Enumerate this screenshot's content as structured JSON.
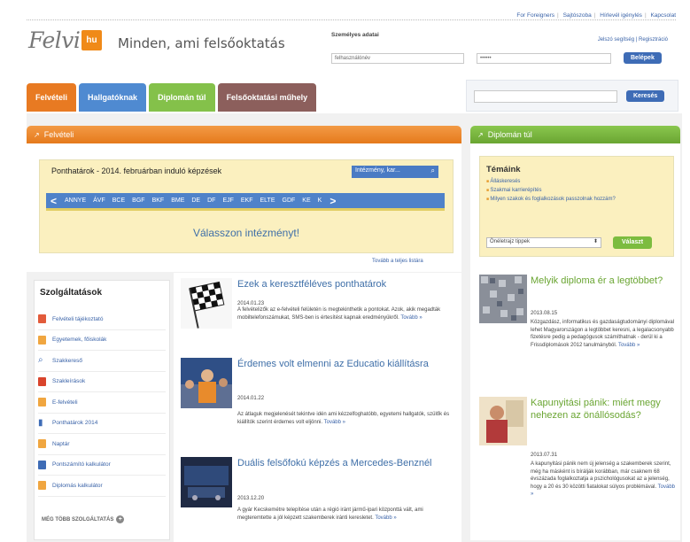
{
  "toplinks": [
    "For Foreigners",
    "Sajtószoba",
    "Hírlevél igénylés",
    "Kapcsolat"
  ],
  "logo": {
    "word": "Felvi",
    "box": "hu"
  },
  "tagline": "Minden, ami felsőoktatás",
  "login": {
    "title": "Személyes adatai",
    "links": [
      "Jelszó segítség",
      "Regisztráció"
    ],
    "user_value": "felhasználónév",
    "pass_value": "••••••",
    "button": "Belépek"
  },
  "nav": [
    {
      "label": "Felvételi",
      "color": "#e87a22"
    },
    {
      "label": "Hallgatóknak",
      "color": "#4f8ad1"
    },
    {
      "label": "Diplomán túl",
      "color": "#84c14a"
    },
    {
      "label": "Felsőoktatási műhely",
      "color": "#8c5f5c"
    }
  ],
  "search": {
    "button": "Keresés"
  },
  "felveteli": {
    "heading": "Felvételi",
    "inst_title": "Ponthatárok - 2014. februárban induló képzések",
    "inst_search": "Intézmény, kar...",
    "abc": [
      "ANNYE",
      "ÁVF",
      "BCE",
      "BGF",
      "BKF",
      "BME",
      "DE",
      "DF",
      "EJF",
      "EKF",
      "ELTE",
      "GDF",
      "KE",
      "K"
    ],
    "choose": "Válasszon intézményt!",
    "more": "Tovább a teljes listára"
  },
  "services": {
    "title": "Szolgáltatások",
    "items": [
      {
        "label": "Felvételi tájékoztató",
        "color": "#e25b3b"
      },
      {
        "label": "Egyetemek, főiskolák",
        "color": "#f0a640"
      },
      {
        "label": "Szakkereső",
        "color": "#3e6cb6"
      },
      {
        "label": "Szakleírások",
        "color": "#d9442c"
      },
      {
        "label": "E-felvételi",
        "color": "#f0a640"
      },
      {
        "label": "Ponthatárok 2014",
        "color": "#3e6cb6"
      },
      {
        "label": "Naptár",
        "color": "#f0a640"
      },
      {
        "label": "Pontszámító kalkulátor",
        "color": "#3e6cb6"
      },
      {
        "label": "Diplomás kalkulátor",
        "color": "#f0a640"
      }
    ],
    "more": "MÉG TÖBB SZOLGÁLTATÁS"
  },
  "news": [
    {
      "title": "Ezek a keresztféléves ponthatárok",
      "date": "2014.01.23",
      "lead": "A felvételizők az e-felvételi felületén is megtekinthetik a pontokat. Azok, akik megadták mobiltelefonszámukat, SMS-ben is értesítést kapnak eredményükről.",
      "more": "Tovább »"
    },
    {
      "title": "Érdemes volt elmenni az Educatio kiállításra",
      "date": "2014.01.22",
      "lead": "Az átlaguk megjelenését tekintve idén ami kézzelfoghatóbb, egyetemi hallgatók, szülők és kiállítók szerint érdemes volt eljönni.",
      "more": "Tovább »"
    },
    {
      "title": "Duális felsőfokú képzés a Mercedes-Benznél",
      "date": "2013.12.20",
      "lead": "A gyár Kecskemétre telepítése után a régió iránt jármű-ipari központtá vált, ami megteremtette a jól képzett szakemberek iránti keresletet.",
      "more": "Tovább »"
    }
  ],
  "diploman": {
    "heading": "Diplomán túl",
    "tem_title": "Témáink",
    "topics": [
      "Álláskeresés",
      "Szakmai karrierépítés",
      "Milyen szakok és foglalkozások passzolnak hozzám?"
    ],
    "select": "Önéletrajz tippek",
    "button": "Választ",
    "news": [
      {
        "title": "Melyik diploma ér a legtöbbet?",
        "date": "2013.08.15",
        "lead": "Közgazdász, informatikus és gazdaságtudományi diplomával lehet Magyarországon a legtöbbet keresni, a legalacsonyabb fizetésre pedig a pedagógusok számíthatnak - derül ki a Frissdiplomások 2012 tanulmányból.",
        "more": "Tovább »"
      },
      {
        "title": "Kapunyitási pánik: miért megy nehezen az önállósodás?",
        "date": "2013.07.31",
        "lead": "A kapunyitási pánik nem új jelenség a szakemberek szerint, még ha másként is bírálják korábban, már csaknem 68 évszázada foglalkoztatja a pszichológusokat az a jelenség, hogy a 20 és 30 közötti fiatalokat súlyos problémával.",
        "more": "Tovább »"
      }
    ]
  }
}
